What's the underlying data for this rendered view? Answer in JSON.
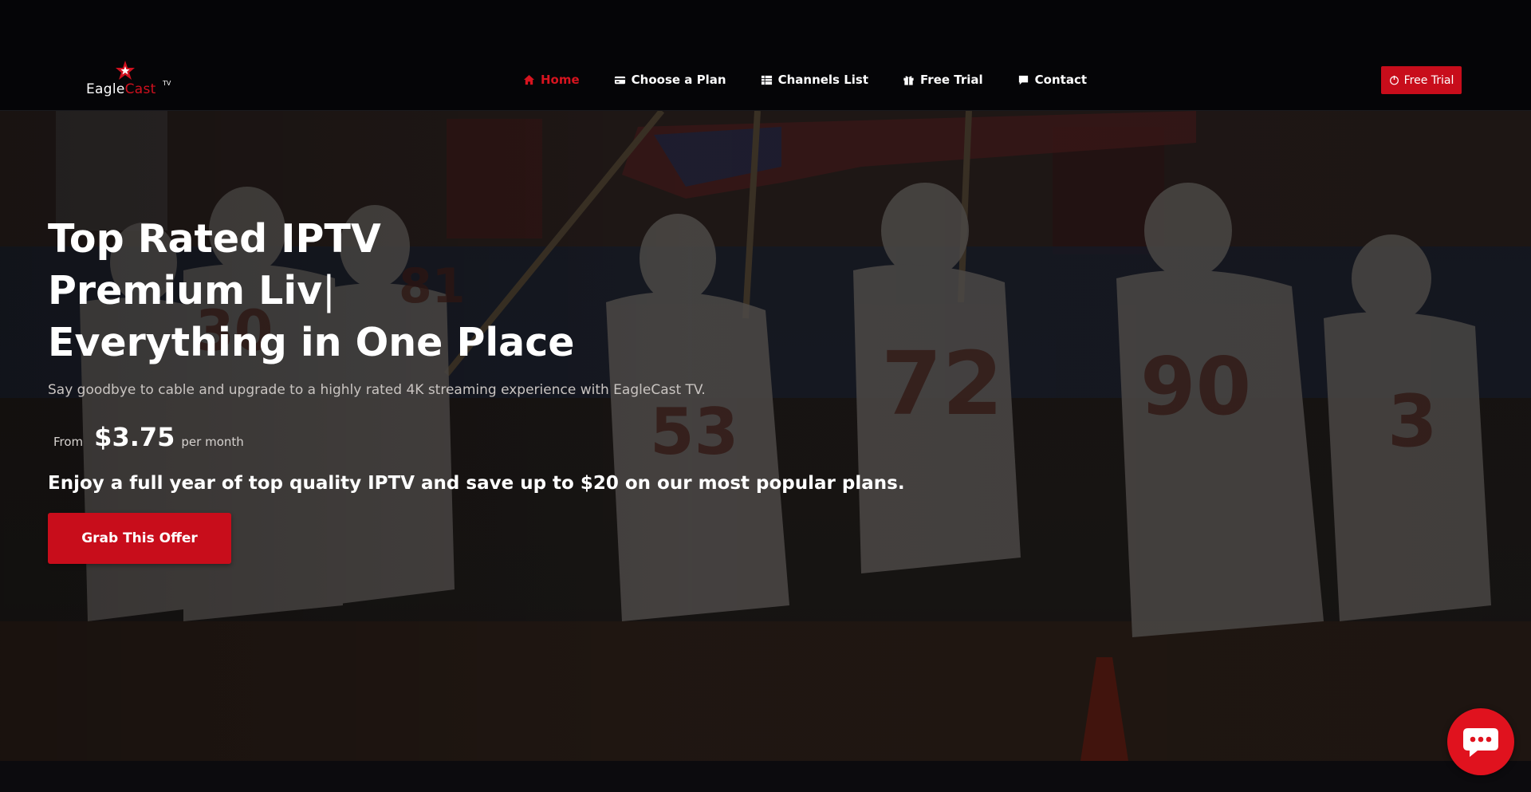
{
  "header": {
    "logo": {
      "text_white": "Eagle",
      "text_red": "Cast",
      "sup": "TV"
    },
    "nav": [
      {
        "label": "Home",
        "icon": "home-icon",
        "active": true
      },
      {
        "label": "Choose a Plan",
        "icon": "credit-card-icon",
        "active": false
      },
      {
        "label": "Channels List",
        "icon": "table-list-icon",
        "active": false
      },
      {
        "label": "Free Trial",
        "icon": "gift-icon",
        "active": false
      },
      {
        "label": "Contact",
        "icon": "comment-icon",
        "active": false
      }
    ],
    "cta": {
      "label": "Free Trial",
      "icon": "power-icon"
    }
  },
  "hero": {
    "title_line1": "Top Rated IPTV",
    "title_line2_plain": "Premium ",
    "title_line2_bold": "Liv",
    "title_cursor": "|",
    "title_line3": "Everything in One Place",
    "subtitle": "Say goodbye to cable and upgrade to a highly rated 4K streaming experience with EagleCast TV.",
    "price": {
      "from": "From",
      "amount": "$3.75",
      "per": "per month"
    },
    "promo": "Enjoy a full year of top quality IPTV and save up to $20 on our most popular plans.",
    "button": "Grab This Offer"
  },
  "chat": {
    "icon": "chat-bubble-icon"
  },
  "colors": {
    "accent": "#c80d1b",
    "nav_active": "#d7141f",
    "header_bg": "#050507"
  }
}
